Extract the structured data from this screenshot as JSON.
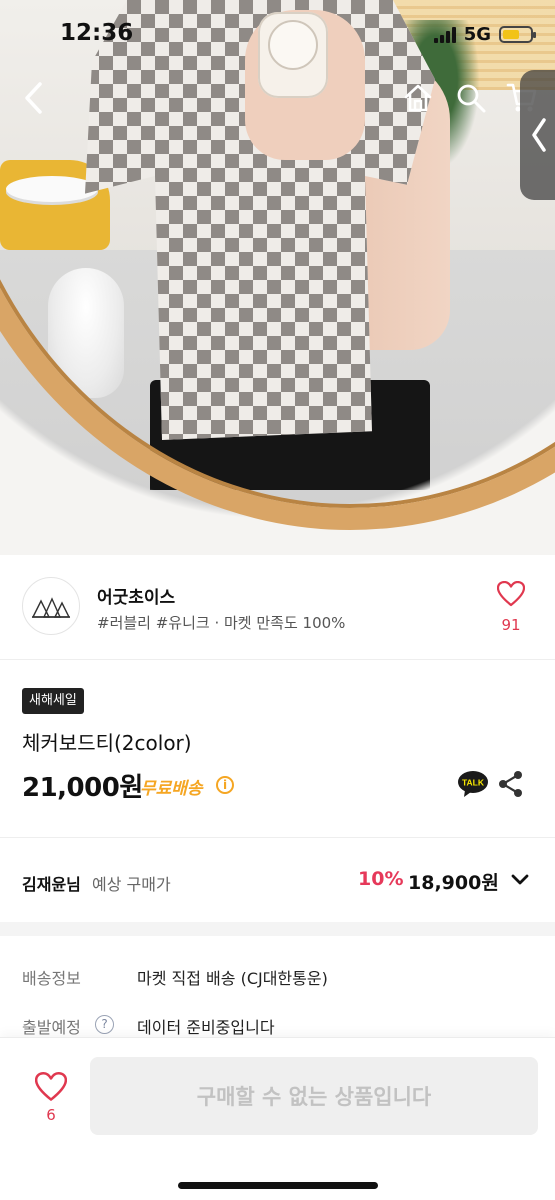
{
  "status_bar": {
    "time": "12:36",
    "network": "5G"
  },
  "hero": {
    "icons": [
      "back-icon",
      "home-icon",
      "search-icon",
      "cart-icon",
      "chevron-left-icon"
    ]
  },
  "shop": {
    "name": "어굿초이스",
    "tags": "#러블리 #유니크 · 마켓 만족도 100%",
    "like_count": "91"
  },
  "product": {
    "badge": "새해세일",
    "title": "체커보드티(2color)",
    "price": "21,000원",
    "shipping_badge": "무료배송",
    "talk_label": "TALK"
  },
  "member_price": {
    "name": "김재윤님",
    "suffix": "예상 구매가",
    "discount": "10%",
    "price": "18,900원"
  },
  "shipping_info": {
    "rows": [
      {
        "label": "배송정보",
        "value": "마켓 직접 배송 (CJ대한통운)"
      },
      {
        "label": "출발예정",
        "value": "데이터 준비중입니다"
      }
    ],
    "help_glyph": "?"
  },
  "bottom_bar": {
    "like_count": "6",
    "buy_label": "구매할 수 없는 상품입니다"
  },
  "colors": {
    "accent_red": "#e6395a",
    "free_ship_orange": "#f5a623",
    "disabled_button": "#efefef"
  }
}
